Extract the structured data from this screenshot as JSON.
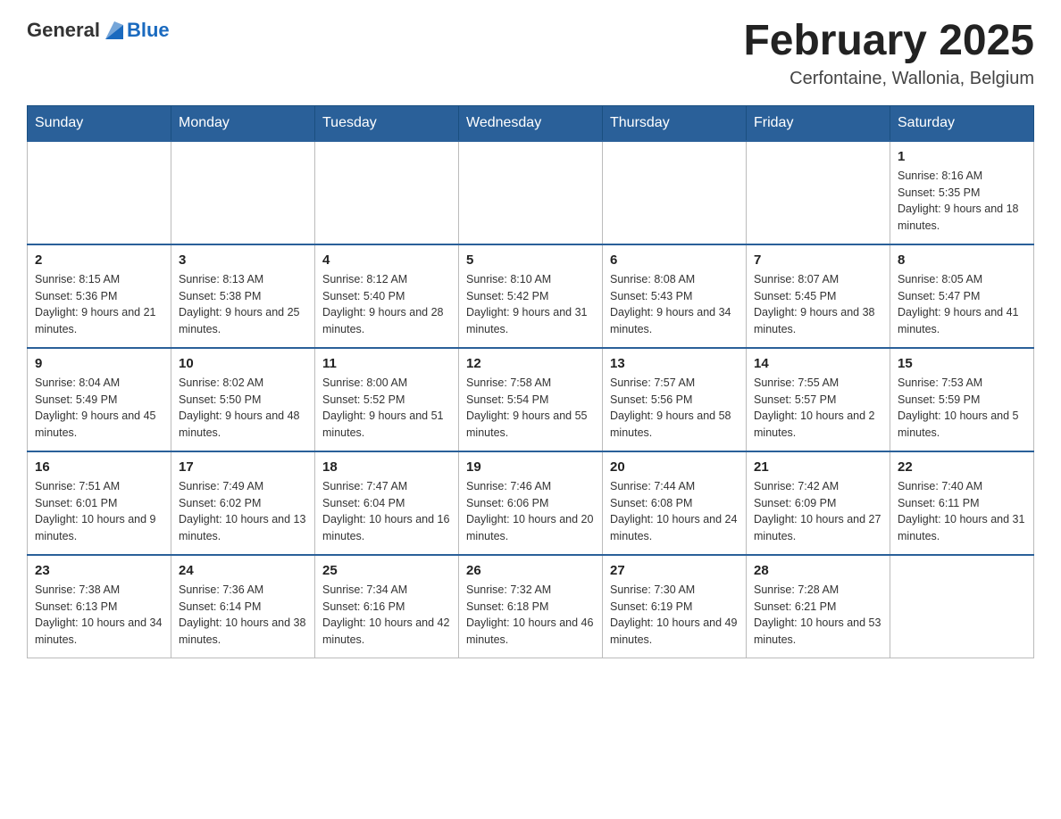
{
  "header": {
    "logo_general": "General",
    "logo_blue": "Blue",
    "month_year": "February 2025",
    "location": "Cerfontaine, Wallonia, Belgium"
  },
  "weekdays": [
    "Sunday",
    "Monday",
    "Tuesday",
    "Wednesday",
    "Thursday",
    "Friday",
    "Saturday"
  ],
  "weeks": [
    [
      null,
      null,
      null,
      null,
      null,
      null,
      {
        "day": "1",
        "sunrise": "Sunrise: 8:16 AM",
        "sunset": "Sunset: 5:35 PM",
        "daylight": "Daylight: 9 hours and 18 minutes."
      }
    ],
    [
      {
        "day": "2",
        "sunrise": "Sunrise: 8:15 AM",
        "sunset": "Sunset: 5:36 PM",
        "daylight": "Daylight: 9 hours and 21 minutes."
      },
      {
        "day": "3",
        "sunrise": "Sunrise: 8:13 AM",
        "sunset": "Sunset: 5:38 PM",
        "daylight": "Daylight: 9 hours and 25 minutes."
      },
      {
        "day": "4",
        "sunrise": "Sunrise: 8:12 AM",
        "sunset": "Sunset: 5:40 PM",
        "daylight": "Daylight: 9 hours and 28 minutes."
      },
      {
        "day": "5",
        "sunrise": "Sunrise: 8:10 AM",
        "sunset": "Sunset: 5:42 PM",
        "daylight": "Daylight: 9 hours and 31 minutes."
      },
      {
        "day": "6",
        "sunrise": "Sunrise: 8:08 AM",
        "sunset": "Sunset: 5:43 PM",
        "daylight": "Daylight: 9 hours and 34 minutes."
      },
      {
        "day": "7",
        "sunrise": "Sunrise: 8:07 AM",
        "sunset": "Sunset: 5:45 PM",
        "daylight": "Daylight: 9 hours and 38 minutes."
      },
      {
        "day": "8",
        "sunrise": "Sunrise: 8:05 AM",
        "sunset": "Sunset: 5:47 PM",
        "daylight": "Daylight: 9 hours and 41 minutes."
      }
    ],
    [
      {
        "day": "9",
        "sunrise": "Sunrise: 8:04 AM",
        "sunset": "Sunset: 5:49 PM",
        "daylight": "Daylight: 9 hours and 45 minutes."
      },
      {
        "day": "10",
        "sunrise": "Sunrise: 8:02 AM",
        "sunset": "Sunset: 5:50 PM",
        "daylight": "Daylight: 9 hours and 48 minutes."
      },
      {
        "day": "11",
        "sunrise": "Sunrise: 8:00 AM",
        "sunset": "Sunset: 5:52 PM",
        "daylight": "Daylight: 9 hours and 51 minutes."
      },
      {
        "day": "12",
        "sunrise": "Sunrise: 7:58 AM",
        "sunset": "Sunset: 5:54 PM",
        "daylight": "Daylight: 9 hours and 55 minutes."
      },
      {
        "day": "13",
        "sunrise": "Sunrise: 7:57 AM",
        "sunset": "Sunset: 5:56 PM",
        "daylight": "Daylight: 9 hours and 58 minutes."
      },
      {
        "day": "14",
        "sunrise": "Sunrise: 7:55 AM",
        "sunset": "Sunset: 5:57 PM",
        "daylight": "Daylight: 10 hours and 2 minutes."
      },
      {
        "day": "15",
        "sunrise": "Sunrise: 7:53 AM",
        "sunset": "Sunset: 5:59 PM",
        "daylight": "Daylight: 10 hours and 5 minutes."
      }
    ],
    [
      {
        "day": "16",
        "sunrise": "Sunrise: 7:51 AM",
        "sunset": "Sunset: 6:01 PM",
        "daylight": "Daylight: 10 hours and 9 minutes."
      },
      {
        "day": "17",
        "sunrise": "Sunrise: 7:49 AM",
        "sunset": "Sunset: 6:02 PM",
        "daylight": "Daylight: 10 hours and 13 minutes."
      },
      {
        "day": "18",
        "sunrise": "Sunrise: 7:47 AM",
        "sunset": "Sunset: 6:04 PM",
        "daylight": "Daylight: 10 hours and 16 minutes."
      },
      {
        "day": "19",
        "sunrise": "Sunrise: 7:46 AM",
        "sunset": "Sunset: 6:06 PM",
        "daylight": "Daylight: 10 hours and 20 minutes."
      },
      {
        "day": "20",
        "sunrise": "Sunrise: 7:44 AM",
        "sunset": "Sunset: 6:08 PM",
        "daylight": "Daylight: 10 hours and 24 minutes."
      },
      {
        "day": "21",
        "sunrise": "Sunrise: 7:42 AM",
        "sunset": "Sunset: 6:09 PM",
        "daylight": "Daylight: 10 hours and 27 minutes."
      },
      {
        "day": "22",
        "sunrise": "Sunrise: 7:40 AM",
        "sunset": "Sunset: 6:11 PM",
        "daylight": "Daylight: 10 hours and 31 minutes."
      }
    ],
    [
      {
        "day": "23",
        "sunrise": "Sunrise: 7:38 AM",
        "sunset": "Sunset: 6:13 PM",
        "daylight": "Daylight: 10 hours and 34 minutes."
      },
      {
        "day": "24",
        "sunrise": "Sunrise: 7:36 AM",
        "sunset": "Sunset: 6:14 PM",
        "daylight": "Daylight: 10 hours and 38 minutes."
      },
      {
        "day": "25",
        "sunrise": "Sunrise: 7:34 AM",
        "sunset": "Sunset: 6:16 PM",
        "daylight": "Daylight: 10 hours and 42 minutes."
      },
      {
        "day": "26",
        "sunrise": "Sunrise: 7:32 AM",
        "sunset": "Sunset: 6:18 PM",
        "daylight": "Daylight: 10 hours and 46 minutes."
      },
      {
        "day": "27",
        "sunrise": "Sunrise: 7:30 AM",
        "sunset": "Sunset: 6:19 PM",
        "daylight": "Daylight: 10 hours and 49 minutes."
      },
      {
        "day": "28",
        "sunrise": "Sunrise: 7:28 AM",
        "sunset": "Sunset: 6:21 PM",
        "daylight": "Daylight: 10 hours and 53 minutes."
      },
      null
    ]
  ]
}
